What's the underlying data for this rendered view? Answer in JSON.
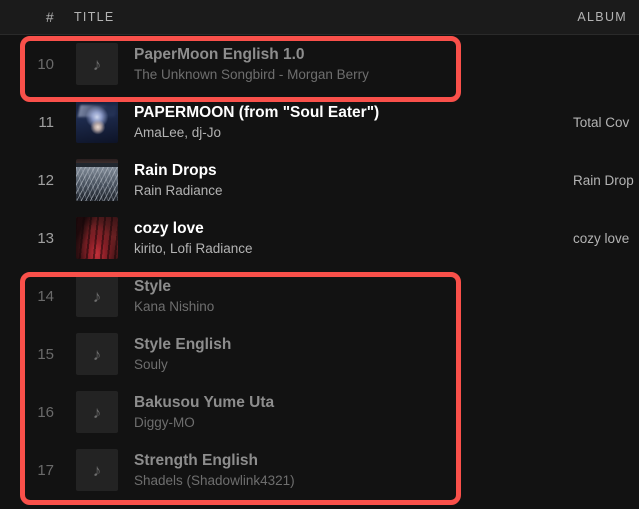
{
  "header": {
    "index_label": "#",
    "title_label": "TITLE",
    "album_label": "ALBUM"
  },
  "tracks": [
    {
      "index": "10",
      "title": "PaperMoon English 1.0",
      "artist": "The Unknown Songbird - Morgan Berry",
      "album": "",
      "art": "music-note-placeholder",
      "unavailable": true
    },
    {
      "index": "11",
      "title": "PAPERMOON (from \"Soul Eater\")",
      "artist": "AmaLee, dj-Jo",
      "album": "Total Cov",
      "art": "album-cover-papermoon",
      "unavailable": false
    },
    {
      "index": "12",
      "title": "Rain Drops",
      "artist": "Rain Radiance",
      "album": "Rain Drop",
      "art": "album-cover-raindrops",
      "unavailable": false
    },
    {
      "index": "13",
      "title": "cozy love",
      "artist": "kirito, Lofi Radiance",
      "album": "cozy love",
      "art": "album-cover-cozylove",
      "unavailable": false
    },
    {
      "index": "14",
      "title": "Style",
      "artist": "Kana Nishino",
      "album": "",
      "art": "music-note-placeholder",
      "unavailable": true
    },
    {
      "index": "15",
      "title": "Style English",
      "artist": "Souly",
      "album": "",
      "art": "music-note-placeholder",
      "unavailable": true
    },
    {
      "index": "16",
      "title": "Bakusou Yume Uta",
      "artist": "Diggy-MO",
      "album": "",
      "art": "music-note-placeholder",
      "unavailable": true
    },
    {
      "index": "17",
      "title": "Strength English",
      "artist": "Shadels (Shadowlink4321)",
      "album": "",
      "art": "music-note-placeholder",
      "unavailable": true
    }
  ],
  "annotations": {
    "color": "#f9504a",
    "boxes": [
      {
        "name": "highlight-track-10",
        "target_index": "10"
      },
      {
        "name": "highlight-tracks-14-17",
        "target_index": "14-17"
      }
    ]
  },
  "icons": {
    "music_note": "♪"
  }
}
